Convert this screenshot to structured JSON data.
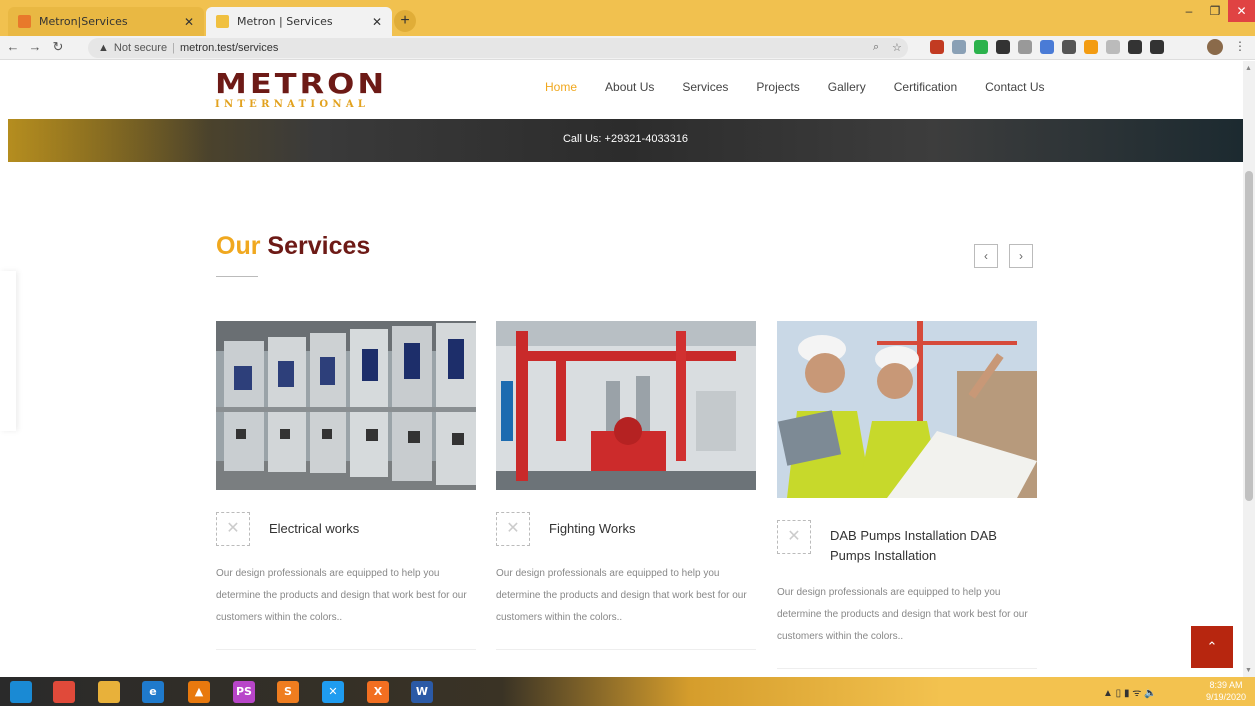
{
  "browser": {
    "tabs": [
      {
        "title": "Metron|Services",
        "active": false,
        "favicon_color": "#e8792b"
      },
      {
        "title": "Metron | Services",
        "active": true,
        "favicon_color": "#f0c040"
      }
    ],
    "new_tab_icon": "plus-icon",
    "address": {
      "security": "Not secure",
      "url": "metron.test/services"
    },
    "extension_colors": [
      "#c23b22",
      "#8aa0b5",
      "#2bb24c",
      "#333333",
      "#999999",
      "#4a7bd6",
      "#555555",
      "#f39c12",
      "#bbbbbb",
      "#333333",
      "#333333"
    ]
  },
  "site": {
    "logo": {
      "main": "METRON",
      "sub": "INTERNATIONAL"
    },
    "nav": [
      {
        "label": "Home",
        "active": true
      },
      {
        "label": "About Us",
        "active": false
      },
      {
        "label": "Services",
        "active": false
      },
      {
        "label": "Projects",
        "active": false
      },
      {
        "label": "Gallery",
        "active": false
      },
      {
        "label": "Certification",
        "active": false
      },
      {
        "label": "Contact Us",
        "active": false
      }
    ],
    "banner": {
      "call": "Call Us: +29321-4033316"
    },
    "section": {
      "title_accent": "Our",
      "title_rest": "Services"
    },
    "carousel": {
      "prev": "‹",
      "next": "›"
    },
    "services": [
      {
        "name": "Electrical works",
        "description": "Our design professionals are equipped to help you determine the products and design that work best for our customers within the colors..",
        "image": "electrical-panel-photo"
      },
      {
        "name": "Fighting Works",
        "description": "Our design professionals are equipped to help you determine the products and design that work best for our customers within the colors..",
        "image": "fire-pump-room-photo"
      },
      {
        "name": "DAB Pumps Installation DAB Pumps Installation",
        "description": "Our design professionals are equipped to help you determine the products and design that work best for our customers within the colors..",
        "image": "engineers-photo"
      }
    ],
    "to_top": "⌃"
  },
  "taskbar": {
    "icons": [
      {
        "name": "windows-start-icon",
        "label": "",
        "color": "#1a8ad4"
      },
      {
        "name": "chrome-icon",
        "label": "",
        "color": "#e04a3a"
      },
      {
        "name": "file-explorer-icon",
        "label": "",
        "color": "#e8b13a"
      },
      {
        "name": "ie-icon",
        "label": "e",
        "color": "#1f7acc"
      },
      {
        "name": "vlc-icon",
        "label": "▲",
        "color": "#e8790e"
      },
      {
        "name": "phpstorm-icon",
        "label": "PS",
        "color": "#b845c9"
      },
      {
        "name": "sublime-icon",
        "label": "S",
        "color": "#ef7d1f"
      },
      {
        "name": "vscode-icon",
        "label": "✕",
        "color": "#1f9cf0"
      },
      {
        "name": "xampp-icon",
        "label": "X",
        "color": "#f26f21"
      },
      {
        "name": "word-icon",
        "label": "W",
        "color": "#2b5aa6"
      }
    ],
    "time": "8:39 AM",
    "date": "9/19/2020"
  }
}
